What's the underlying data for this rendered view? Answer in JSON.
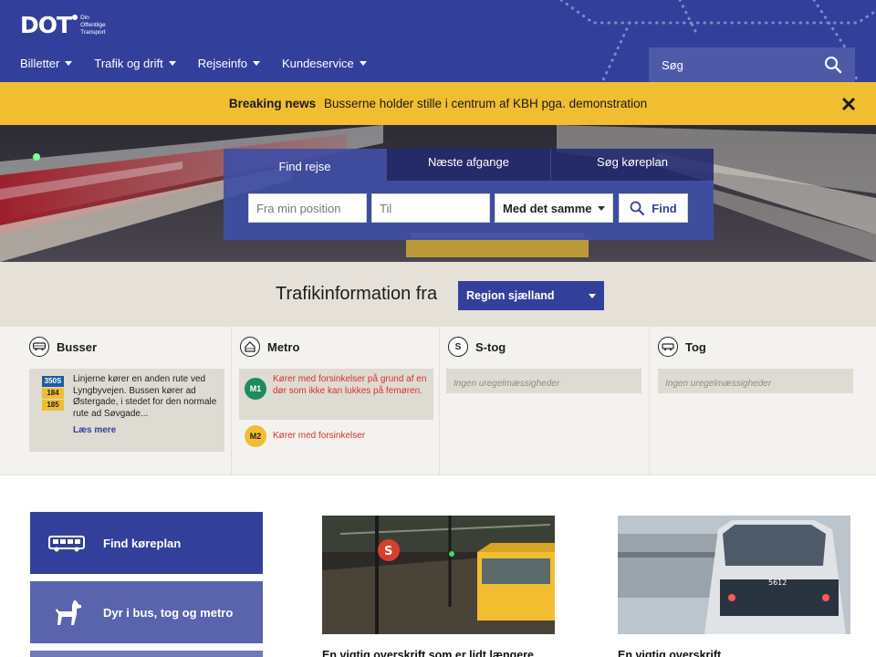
{
  "header": {
    "logo_text": "DOT",
    "logo_tagline": [
      "Din",
      "Offentlige",
      "Transport"
    ],
    "nav": [
      {
        "label": "Billetter"
      },
      {
        "label": "Trafik og drift"
      },
      {
        "label": "Rejseinfo"
      },
      {
        "label": "Kundeservice"
      }
    ],
    "search_placeholder": "Søg",
    "brand_color": "#33409b"
  },
  "breaking_news": {
    "label": "Breaking news",
    "message": "Busserne holder stille i centrum af KBH pga. demonstration",
    "color": "#f1be31"
  },
  "journey_planner": {
    "tabs": [
      "Find rejse",
      "Næste afgange",
      "Søg køreplan"
    ],
    "from_placeholder": "Fra min position",
    "to_placeholder": "Til",
    "time_option": "Med det samme",
    "find_label": "Find"
  },
  "traffic": {
    "title": "Trafikinformation fra",
    "region": "Region sjælland",
    "columns": [
      {
        "name": "Busser",
        "icon": "bus-icon",
        "badges": [
          "350S",
          "184",
          "185"
        ],
        "message": "Linjerne kører en anden rute ved Lyngbyvejen. Bussen kører ad Østergade, i stedet for den normale rute ad Søvgade...",
        "link": "Læs mere"
      },
      {
        "name": "Metro",
        "icon": "metro-icon",
        "items": [
          {
            "line": "M1",
            "color": "#1f8a5b",
            "message": "Kører med forsinkelser på grund af en dør som ikke kan lukkes på femøren."
          },
          {
            "line": "M2",
            "color": "#f1be31",
            "message": "Kører med forsinkelser"
          }
        ]
      },
      {
        "name": "S-tog",
        "icon": "s-train-icon",
        "message": "Ingen uregelmæssigheder"
      },
      {
        "name": "Tog",
        "icon": "train-icon",
        "message": "Ingen uregelmæssigheder"
      }
    ]
  },
  "quick_links": [
    {
      "label": "Find køreplan",
      "icon": "bus-icon",
      "color": "#33409b"
    },
    {
      "label": "Dyr i bus, tog og metro",
      "icon": "dog-icon",
      "color": "#5a64ad"
    }
  ],
  "news": [
    {
      "title": "En vigtig overskrift som er lidt længere"
    },
    {
      "title": "En vigtig overskrift"
    }
  ]
}
